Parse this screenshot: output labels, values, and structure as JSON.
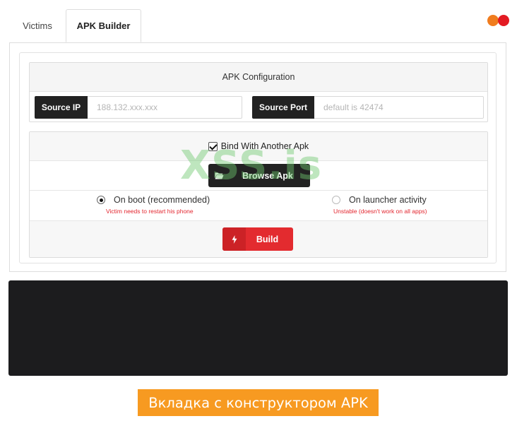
{
  "tabs": [
    {
      "label": "Victims",
      "active": false
    },
    {
      "label": "APK Builder",
      "active": true
    }
  ],
  "brand_dots": {
    "colors": [
      "#f07c1e",
      "#e31b23"
    ]
  },
  "config": {
    "header": "APK Configuration",
    "source_ip": {
      "label": "Source IP",
      "placeholder": "188.132.xxx.xxx"
    },
    "source_port": {
      "label": "Source Port",
      "placeholder": "default is 42474"
    }
  },
  "bind": {
    "checkbox_label": "Bind With Another Apk",
    "checked": true,
    "browse_button": "Browse Apk",
    "browse_icon": "folder-open-icon"
  },
  "options": [
    {
      "label": "On boot (recommended)",
      "hint": "Victim needs to restart his phone",
      "selected": true
    },
    {
      "label": "On launcher activity",
      "hint": "Unstable (doesn't work on all apps)",
      "selected": false
    }
  ],
  "build": {
    "label": "Build",
    "icon": "lightning-bolt-icon",
    "color": "#e32b2f"
  },
  "watermark": "XSS.is",
  "caption": "Вкладка с конструктором APK",
  "colors": {
    "accent_orange": "#f79a21",
    "build_red": "#e32b2f",
    "dark": "#222222"
  }
}
